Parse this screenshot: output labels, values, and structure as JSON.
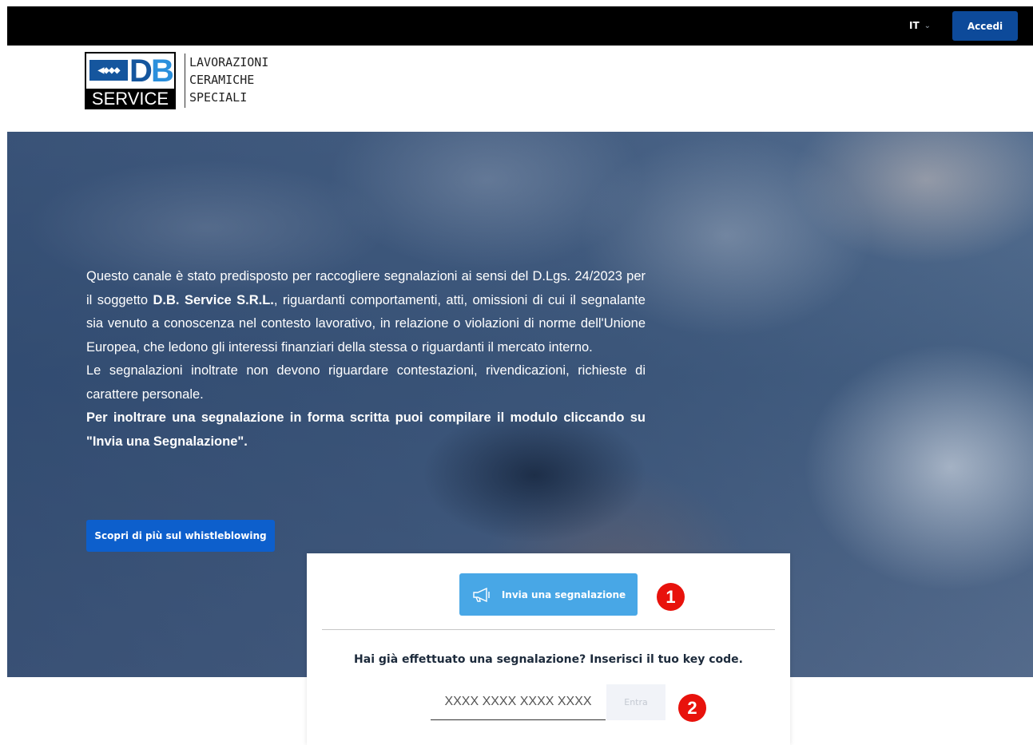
{
  "header": {
    "language": "IT",
    "login_label": "Accedi"
  },
  "logo": {
    "mark_top": "DB",
    "mark_bottom": "SERVICE",
    "tagline": [
      "LAVORAZIONI",
      "CERAMICHE",
      "SPECIALI"
    ]
  },
  "hero": {
    "intro_before": "Questo canale è stato predisposto per raccogliere segnalazioni ai sensi del D.Lgs. 24/2023 per il soggetto ",
    "company": "D.B. Service S.R.L.",
    "intro_after": ", riguardanti comportamenti, atti, omissioni di cui il segnalante sia venuto a conoscenza nel contesto lavorativo, in relazione o violazioni di norme dell'Unione Europea, che ledono gli interessi finanziari della stessa o riguardanti il mercato interno.",
    "note": "Le segnalazioni inoltrate non devono riguardare contestazioni, rivendicazioni, richieste di carattere personale.",
    "cta_text": "Per inoltrare una segnalazione in forma scritta puoi compilare il modulo cliccando su \"Invia una Segnalazione\".",
    "learn_more_label": "Scopri di più sul whistleblowing"
  },
  "report_card": {
    "send_label": "Invia una segnalazione",
    "question": "Hai già effettuato una segnalazione? Inserisci il tuo key code.",
    "keycode_placeholder": "XXXX XXXX XXXX XXXX",
    "enter_label": "Entra"
  },
  "annotations": {
    "badge_1": "1",
    "badge_2": "2"
  },
  "colors": {
    "primary_blue": "#0d4a9a",
    "light_blue": "#48a7e6",
    "annotation_red": "#e8120c"
  },
  "icons": {
    "send_button_icon": "megaphone-icon",
    "language_chevron": "chevron-down-icon"
  }
}
